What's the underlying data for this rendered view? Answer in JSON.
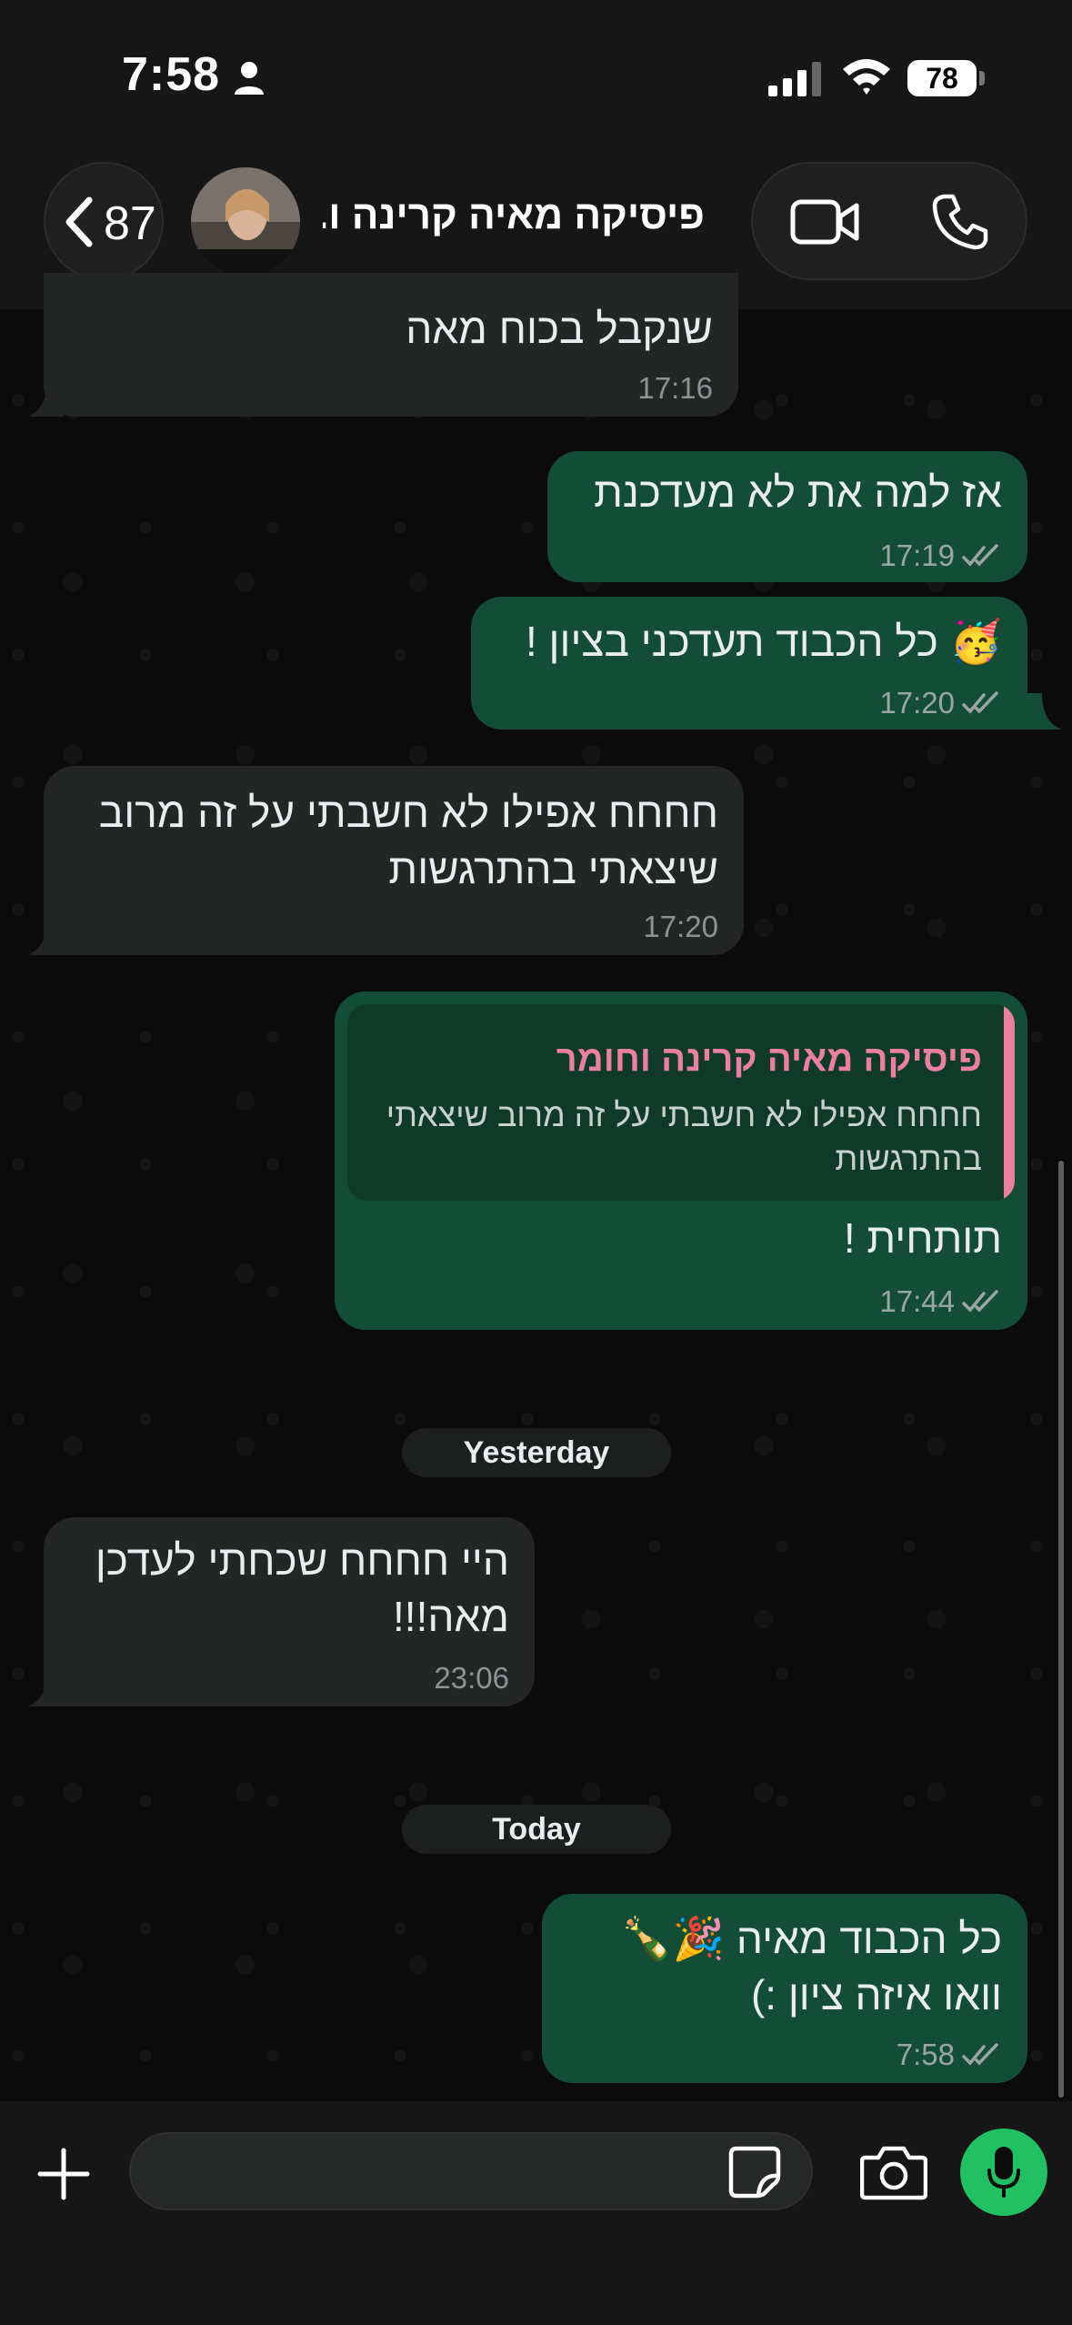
{
  "status_bar": {
    "time": "7:58",
    "battery": "78"
  },
  "header": {
    "back_count": "87",
    "chat_title": "פיסיקה מאיה קרינה ו..."
  },
  "messages": [
    {
      "text": "שנקבל בכוח מאה",
      "time": "17:16"
    },
    {
      "text": "אז למה את לא מעדכנת",
      "time": "17:19"
    },
    {
      "emoji": "🥳",
      "text": "כל הכבוד תעדכני בציון !",
      "time": "17:20"
    },
    {
      "text": "חחחח אפילו לא חשבתי על זה מרוב שיצאתי בהתרגשות",
      "time": "17:20"
    },
    {
      "quote_author": "פיסיקה מאיה קרינה וחומר",
      "quote_text": "חחחח אפילו לא חשבתי על זה מרוב שיצאתי בהתרגשות",
      "text": "תותחית !",
      "time": "17:44"
    },
    {
      "text": "היי חחחח שכחתי לעדכן מאה!!!",
      "time": "23:06"
    },
    {
      "text": "כל הכבוד מאיה 🎉🍾 וואו איזה ציון :)",
      "time": "7:58"
    }
  ],
  "dates": {
    "yesterday": "Yesterday",
    "today": "Today"
  },
  "input": {
    "value": ""
  },
  "colors": {
    "outgoing": "#134d37",
    "incoming": "#242626",
    "accent": "#21c063",
    "quote_author": "#ea7fa1"
  }
}
